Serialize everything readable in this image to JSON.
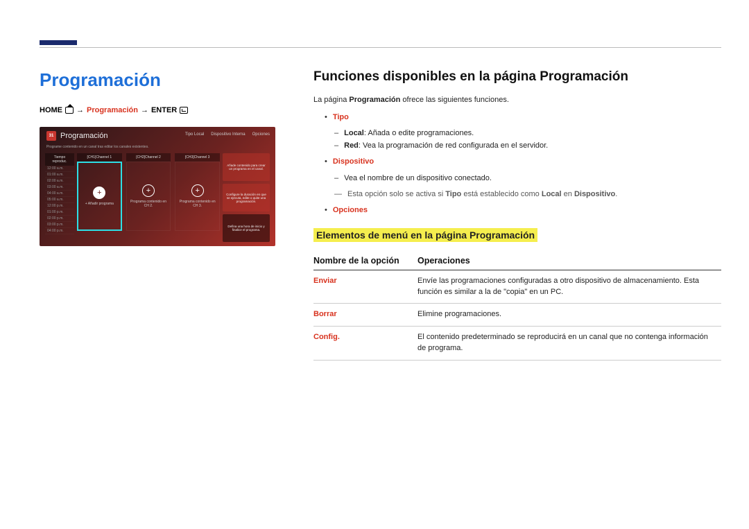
{
  "left": {
    "title": "Programación",
    "breadcrumb": {
      "home": "HOME",
      "arrow": "→",
      "mid": "Programación",
      "enter": "ENTER"
    },
    "screenshot": {
      "cal_icon": "31",
      "title": "Programación",
      "top_right": {
        "tipo": "Tipo  Local",
        "disp": "Dispositivo Interna",
        "opc": "Opciones"
      },
      "subtitle": "Programe contenido en un canal tras editar los canales existentes.",
      "time_header": "Tiempo reproduc.",
      "times": [
        "12:00 a.m.",
        "01:00 a.m.",
        "02:00 a.m.",
        "03:00 a.m.",
        "04:00 a.m.",
        "05:00 a.m.",
        "12:00 p.m.",
        "01:00 p.m.",
        "02:00 p.m.",
        "03:00 p.m.",
        "04:00 p.m."
      ],
      "channels": [
        {
          "hd": "[CH1]Channel 1",
          "label": "+ Añadir programa",
          "selected": true
        },
        {
          "hd": "[CH2]Channel 2",
          "label": "Programa contenido en CH 2.",
          "selected": false
        },
        {
          "hd": "[CH3]Channel 3",
          "label": "Programa contenido en CH 3.",
          "selected": false
        }
      ],
      "side": [
        "Añade contenido para crear un programa en el canal.",
        "Configure la duración en que se ejecuta, edite o quite una programación.",
        "Defina una hora de inicio y finalice el programa."
      ]
    }
  },
  "right": {
    "h2": "Funciones disponibles en la página Programación",
    "intro_pre": "La página ",
    "intro_strong": "Programación",
    "intro_post": " ofrece las siguientes funciones.",
    "tipo": {
      "label": "Tipo",
      "local_k": "Local",
      "local_v": ": Añada o edite programaciones.",
      "red_k": "Red",
      "red_v": ": Vea la programación de red configurada en el servidor."
    },
    "dispositivo": {
      "label": "Dispositivo",
      "line": "Vea el nombre de un dispositivo conectado.",
      "note_pre": "Esta opción solo se activa si ",
      "note_tipo": "Tipo",
      "note_mid": " está establecido como ",
      "note_local": "Local",
      "note_en": " en ",
      "note_disp": "Dispositivo",
      "note_end": "."
    },
    "opciones_label": "Opciones",
    "h3": "Elementos de menú en la página Programación",
    "th1": "Nombre de la opción",
    "th2": "Operaciones",
    "rows": [
      {
        "name": "Enviar",
        "desc": "Envíe las programaciones configuradas a otro dispositivo de almacenamiento. Esta función es similar a la de \"copia\" en un PC."
      },
      {
        "name": "Borrar",
        "desc": "Elimine programaciones."
      },
      {
        "name": "Config.",
        "desc": "El contenido predeterminado se reproducirá en un canal que no contenga información de programa."
      }
    ]
  }
}
